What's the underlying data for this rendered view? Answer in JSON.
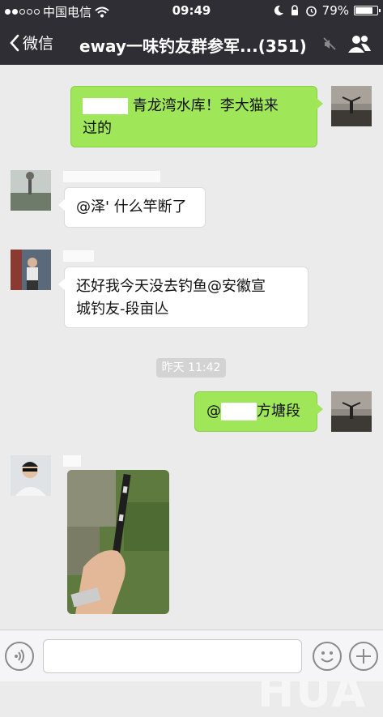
{
  "status_bar": {
    "carrier": "中国电信",
    "time": "09:49",
    "battery": "79%",
    "battery_level": 0.79,
    "signal_dots_filled": 2,
    "signal_dots_total": 5
  },
  "nav": {
    "back_label": "微信",
    "title": "eway一味钓友群参军...(351)",
    "icons": [
      "chevron-left-icon",
      "mute-icon",
      "group-members-icon"
    ]
  },
  "messages": [
    {
      "side": "right",
      "text_line1": "青龙湾水库！李大猫来",
      "text_line2": "过的"
    },
    {
      "side": "left",
      "text": "@泽' 什么竿断了"
    },
    {
      "side": "left",
      "text_line1": "还好我今天没去钓鱼@安徽宣",
      "text_line2": "城钓友-段亩亾"
    },
    {
      "side": "center",
      "timestamp": "昨天 11:42"
    },
    {
      "side": "right",
      "text_prefix": "@",
      "text_suffix": "方塘段"
    },
    {
      "side": "left",
      "image": "fishing-rod-photo"
    }
  ],
  "input_bar": {
    "icons": [
      "voice-icon",
      "emoji-icon",
      "plus-icon"
    ]
  },
  "watermark": "HUA",
  "colors": {
    "header_bg": "#2e2e34",
    "chat_bg": "#ebebeb",
    "right_bubble": "#9fe659",
    "left_bubble": "#ffffff"
  }
}
